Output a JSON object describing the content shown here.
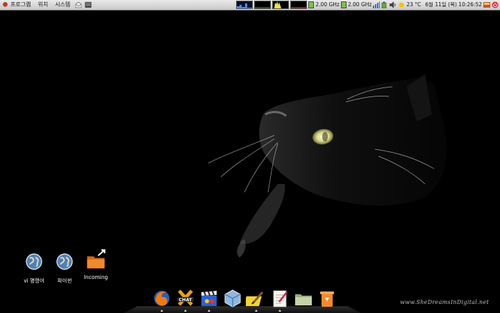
{
  "top_panel": {
    "menus": [
      "프로그램",
      "위치",
      "시스템"
    ],
    "cpu_freq_1": "2.00 GHz",
    "cpu_freq_2": "2.00 GHz",
    "weather": "23 °C",
    "clock": "6월 11일 (목) 10:26:52"
  },
  "desktop_icons": [
    {
      "label": "vi 명령어",
      "icon": "globe-icon"
    },
    {
      "label": "파이썬",
      "icon": "globe-icon"
    },
    {
      "label": "Incoming",
      "icon": "folder-icon"
    }
  ],
  "dock": {
    "items": [
      "firefox-icon",
      "chat-icon",
      "movie-icon",
      "virtualbox-icon",
      "text-editor-icon",
      "notes-icon",
      "folder-icon",
      "trash-icon"
    ]
  },
  "watermark": "www.SheDreamsInDigital.net",
  "colors": {
    "panel": "#d8d8d8",
    "accent": "#7ec04b",
    "cat_eye": "#e8e6a0"
  }
}
